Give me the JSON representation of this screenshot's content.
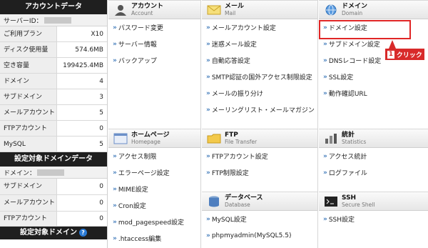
{
  "sidebar": {
    "account_header": "アカウントデータ",
    "server_id_label": "サーバーID：",
    "account_rows": [
      {
        "label": "ご利用プラン",
        "value": "X10"
      },
      {
        "label": "ディスク使用量",
        "value": "574.6MB"
      },
      {
        "label": "空き容量",
        "value": "199425.4MB"
      },
      {
        "label": "ドメイン",
        "value": "4"
      },
      {
        "label": "サブドメイン",
        "value": "3"
      },
      {
        "label": "メールアカウント",
        "value": "5"
      },
      {
        "label": "FTPアカウント",
        "value": "0"
      },
      {
        "label": "MySQL",
        "value": "5"
      }
    ],
    "target_header": "設定対象ドメインデータ",
    "domain_label": "ドメイン：",
    "target_rows": [
      {
        "label": "サブドメイン",
        "value": "0"
      },
      {
        "label": "メールアカウント",
        "value": "0"
      },
      {
        "label": "FTPアカウント",
        "value": "0"
      }
    ],
    "footer_header": "設定対象ドメイン",
    "help_icon": "?"
  },
  "sections": {
    "account": {
      "jp": "アカウント",
      "en": "Account",
      "links": [
        "パスワード変更",
        "サーバー情報",
        "バックアップ"
      ]
    },
    "mail": {
      "jp": "メール",
      "en": "Mail",
      "links": [
        "メールアカウント設定",
        "迷惑メール設定",
        "自動応答設定",
        "SMTP認証の国外アクセス制限設定",
        "メールの振り分け",
        "メーリングリスト・メールマガジン"
      ]
    },
    "domain": {
      "jp": "ドメイン",
      "en": "Domain",
      "links": [
        "ドメイン設定",
        "サブドメイン設定",
        "DNSレコード設定",
        "SSL設定",
        "動作確認URL"
      ]
    },
    "homepage": {
      "jp": "ホームページ",
      "en": "Homepage",
      "links": [
        "アクセス制限",
        "エラーページ設定",
        "MIME設定",
        "Cron設定",
        "mod_pagespeed設定",
        ".htaccess編集"
      ]
    },
    "ftp": {
      "jp": "FTP",
      "en": "File Transfer",
      "links": [
        "FTPアカウント設定",
        "FTP制限設定"
      ]
    },
    "database": {
      "jp": "データベース",
      "en": "Database",
      "links": [
        "MySQL設定",
        "phpmyadmin(MySQL5.5)"
      ]
    },
    "stats": {
      "jp": "統計",
      "en": "Statistics",
      "links": [
        "アクセス統計",
        "ログファイル"
      ]
    },
    "ssh": {
      "jp": "SSH",
      "en": "Secure Shell",
      "links": [
        "SSH設定"
      ]
    }
  },
  "callout": {
    "step": "1",
    "label": "クリック"
  },
  "arrow_glyph": "»"
}
